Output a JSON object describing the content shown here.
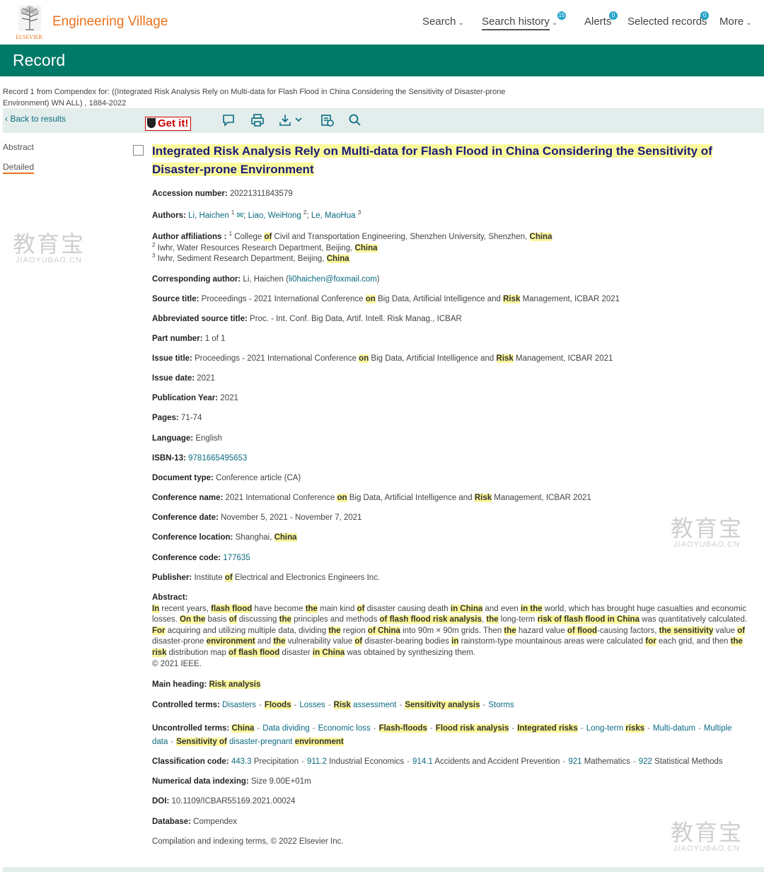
{
  "header": {
    "brand": "Engineering Village",
    "publisher": "ELSEVIER",
    "nav": [
      {
        "label": "Search",
        "badge": null
      },
      {
        "label": "Search history",
        "badge": "15"
      },
      {
        "label": "Alerts",
        "badge": "0"
      },
      {
        "label": "Selected records",
        "badge": "0"
      },
      {
        "label": "More",
        "badge": null
      }
    ]
  },
  "page_title": "Record",
  "record_summary": "Record 1 from Compendex for: ((Integrated Risk Analysis Rely on Multi-data for Flash Flood in China Considering the Sensitivity of Disaster-prone Environment) WN ALL) , 1884-2022",
  "toolbar": {
    "back": "Back to results",
    "getit": "Get it!",
    "icons": [
      "comment-icon",
      "print-icon",
      "download-icon",
      "cite-icon",
      "search-icon"
    ]
  },
  "sidebar": {
    "abstract": "Abstract",
    "detailed": "Detailed"
  },
  "record": {
    "title": "Integrated Risk Analysis Rely on Multi-data for Flash Flood in China Considering the Sensitivity of Disaster-prone Environment",
    "accession_label": "Accession number:",
    "accession": "20221311843579",
    "authors_label": "Authors:",
    "authors": [
      "Li, Haichen",
      "Liao, WeiHong",
      "Le, MaoHua"
    ],
    "author_sups": [
      "1",
      "2",
      "3"
    ],
    "affiliations_label": "Author affiliations :",
    "affiliations": [
      {
        "n": "1",
        "parts": [
          "College ",
          "of",
          " Civil and Transportation Engineering, Shenzhen University, Shenzhen, ",
          "China"
        ]
      },
      {
        "n": "2",
        "parts": [
          "Iwhr, Water Resources Research Department, Beijing, ",
          "China"
        ]
      },
      {
        "n": "3",
        "parts": [
          "Iwhr, Sediment Research Department, Beijing, ",
          "China"
        ]
      }
    ],
    "corresponding_label": "Corresponding author:",
    "corresponding_name": "Li, Haichen (",
    "corresponding_email": "li0haichen@foxmail.com",
    "corresponding_end": ")",
    "source_label": "Source title:",
    "source_parts": [
      "Proceedings - 2021 International Conference ",
      "on",
      " Big Data, Artificial Intelligence and ",
      "Risk",
      " Management, ICBAR 2021"
    ],
    "abbrev_label": "Abbreviated source title:",
    "abbrev": "Proc. - Int. Conf. Big Data, Artif. Intell. Risk Manag., ICBAR",
    "part_label": "Part number:",
    "part": "1 of 1",
    "issue_title_label": "Issue title:",
    "issue_title_parts": [
      "Proceedings - 2021 International Conference ",
      "on",
      " Big Data, Artificial Intelligence and ",
      "Risk",
      " Management, ICBAR 2021"
    ],
    "issue_date_label": "Issue date:",
    "issue_date": "2021",
    "pubyear_label": "Publication Year:",
    "pubyear": "2021",
    "pages_label": "Pages:",
    "pages": "71-74",
    "language_label": "Language:",
    "language": "English",
    "isbn_label": "ISBN-13:",
    "isbn": "9781665495653",
    "doctype_label": "Document type:",
    "doctype": "Conference article (CA)",
    "confname_label": "Conference name:",
    "confname_parts": [
      "2021 International Conference ",
      "on",
      " Big Data, Artificial Intelligence and ",
      "Risk",
      " Management, ICBAR 2021"
    ],
    "confdate_label": "Conference date:",
    "confdate": "November 5, 2021 - November 7, 2021",
    "confloc_label": "Conference location:",
    "confloc_parts": [
      "Shanghai, ",
      "China"
    ],
    "confcode_label": "Conference code:",
    "confcode": "177635",
    "publisher_label": "Publisher:",
    "publisher_parts": [
      "Institute ",
      "of",
      " Electrical and Electronics Engineers Inc."
    ],
    "abstract_label": "Abstract:",
    "abstract_parts": [
      [
        "In",
        "h"
      ],
      [
        " recent years, ",
        ""
      ],
      [
        "flash flood",
        "h"
      ],
      [
        " have become ",
        ""
      ],
      [
        "the",
        "h"
      ],
      [
        " main kind ",
        ""
      ],
      [
        "of",
        "h"
      ],
      [
        " disaster causing death ",
        ""
      ],
      [
        "in China",
        "h"
      ],
      [
        " and even ",
        ""
      ],
      [
        "in the",
        "h"
      ],
      [
        " world, which has brought huge casualties and economic losses. ",
        ""
      ],
      [
        "On the",
        "h"
      ],
      [
        " basis ",
        ""
      ],
      [
        "of",
        "h"
      ],
      [
        " discussing ",
        ""
      ],
      [
        "the",
        "h"
      ],
      [
        " principles and methods ",
        ""
      ],
      [
        "of flash flood risk analysis",
        "h"
      ],
      [
        ", ",
        ""
      ],
      [
        "the",
        "h"
      ],
      [
        " long-term ",
        ""
      ],
      [
        "risk of flash flood in China",
        "h"
      ],
      [
        " was quantitatively calculated. ",
        ""
      ],
      [
        "For",
        "h"
      ],
      [
        " acquiring and utilizing multiple data, dividing ",
        ""
      ],
      [
        "the",
        "h"
      ],
      [
        " region ",
        ""
      ],
      [
        "of China",
        "h"
      ],
      [
        " into 90m × 90m grids. Then ",
        ""
      ],
      [
        "the",
        "h"
      ],
      [
        " hazard value ",
        ""
      ],
      [
        "of flood",
        "h"
      ],
      [
        "-causing factors, ",
        ""
      ],
      [
        "the sensitivity",
        "h"
      ],
      [
        " value ",
        ""
      ],
      [
        "of",
        "h"
      ],
      [
        " disaster-prone ",
        ""
      ],
      [
        "environment",
        "h"
      ],
      [
        " and ",
        ""
      ],
      [
        "the",
        "h"
      ],
      [
        " vulnerability value ",
        ""
      ],
      [
        "of",
        "h"
      ],
      [
        " disaster-bearing bodies ",
        ""
      ],
      [
        "in",
        "h"
      ],
      [
        " rainstorm-type mountainous areas were calculated ",
        ""
      ],
      [
        "for",
        "h"
      ],
      [
        " each grid, and then ",
        ""
      ],
      [
        "the",
        "h"
      ],
      [
        " ",
        ""
      ],
      [
        "risk",
        "h"
      ],
      [
        " distribution map ",
        ""
      ],
      [
        "of flash flood",
        "h"
      ],
      [
        " disaster ",
        ""
      ],
      [
        "in China",
        "h"
      ],
      [
        " was obtained by synthesizing them.",
        ""
      ]
    ],
    "copyright": "© 2021 IEEE.",
    "mainheading_label": "Main heading:",
    "mainheading": "Risk analysis",
    "controlled_label": "Controlled terms:",
    "controlled": [
      [
        [
          "Disasters",
          "l"
        ]
      ],
      [
        [
          "Floods",
          "h"
        ]
      ],
      [
        [
          "Losses",
          "l"
        ]
      ],
      [
        [
          "Risk",
          "h"
        ],
        [
          " assessment",
          "l"
        ]
      ],
      [
        [
          "Sensitivity analysis",
          "h"
        ]
      ],
      [
        [
          "Storms",
          "l"
        ]
      ]
    ],
    "uncontrolled_label": "Uncontrolled terms:",
    "uncontrolled": [
      [
        [
          "China",
          "h"
        ]
      ],
      [
        [
          "Data dividing",
          "l"
        ]
      ],
      [
        [
          "Economic loss",
          "l"
        ]
      ],
      [
        [
          "Flash-floods",
          "h"
        ]
      ],
      [
        [
          "Flood risk analysis",
          "h"
        ]
      ],
      [
        [
          "Integrated risks",
          "h"
        ]
      ],
      [
        [
          "Long-term ",
          "l"
        ],
        [
          "risks",
          "h"
        ]
      ],
      [
        [
          "Multi-datum",
          "l"
        ]
      ],
      [
        [
          "Multiple data",
          "l"
        ]
      ],
      [
        [
          "Sensitivity of",
          "h"
        ],
        [
          " disaster-pregnant ",
          "l"
        ],
        [
          "environment",
          "h"
        ]
      ]
    ],
    "classification_label": "Classification code:",
    "classification": [
      {
        "code": "443.3",
        "name": "Precipitation"
      },
      {
        "code": "911.2",
        "name": "Industrial Economics"
      },
      {
        "code": "914.1",
        "name": "Accidents and Accident Prevention"
      },
      {
        "code": "921",
        "name": "Mathematics"
      },
      {
        "code": "922",
        "name": "Statistical Methods"
      }
    ],
    "numerical_label": "Numerical data indexing:",
    "numerical": "Size 9.00E+01m",
    "doi_label": "DOI:",
    "doi": "10.1109/ICBAR55169.2021.00024",
    "database_label": "Database:",
    "database": "Compendex",
    "compilation": "Compilation and indexing terms, © 2022 Elsevier Inc."
  },
  "watermark": {
    "cn": "教育宝",
    "en": "JIAOYUBAO.CN"
  },
  "colors": {
    "brand": "#e9711c",
    "header": "#007a68",
    "link": "#0b6b80",
    "highlight": "#fbf69a",
    "badge": "#26a3c9",
    "title": "#1a1a7a"
  }
}
